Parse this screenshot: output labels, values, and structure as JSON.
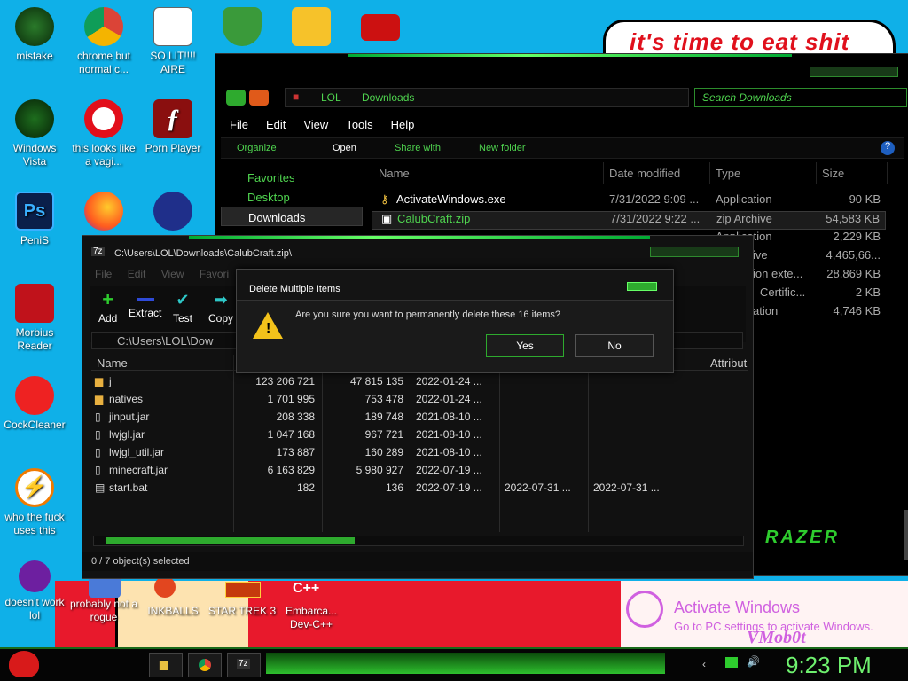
{
  "colors": {
    "desktop": "#0fb0e8",
    "accent_green": "#4fd44f",
    "title_red": "#e0101c",
    "activate": "#d060e0"
  },
  "wallpaper": {
    "caption": "it's time to eat shit",
    "tag": "VMob0t"
  },
  "desktop_icons": [
    {
      "label": "mistake",
      "icon": "green-orb-icon"
    },
    {
      "label": "chrome but normal c...",
      "icon": "chrome-icon"
    },
    {
      "label": "SO LIT!!!! AIRE",
      "icon": "solitaire-icon"
    },
    {
      "label": "",
      "icon": "shield-icon"
    },
    {
      "label": "",
      "icon": "bad-piggies-icon"
    },
    {
      "label": "",
      "icon": "emblem-icon"
    },
    {
      "label": "Windows Vista",
      "icon": "vista-orb-icon"
    },
    {
      "label": "this looks like a vagi...",
      "icon": "opera-icon"
    },
    {
      "label": "Porn Player",
      "icon": "flash-icon"
    },
    {
      "label": "PeniS",
      "icon": "photoshop-icon"
    },
    {
      "label": "",
      "icon": "firefox-icon"
    },
    {
      "label": "",
      "icon": "spider-solitaire-icon"
    },
    {
      "label": "Morbius Reader",
      "icon": "pdf-reader-icon"
    },
    {
      "label": "CockCleaner",
      "icon": "ccleaner-icon"
    },
    {
      "label": "who the fuck uses this",
      "icon": "winamp-icon"
    },
    {
      "label": "doesn't work lol",
      "icon": "yahoo-icon"
    },
    {
      "label": "probably not a rogue",
      "icon": "rogue-icon"
    },
    {
      "label": "INKBALLS",
      "icon": "inkball-icon"
    },
    {
      "label": "STAR TREK 3",
      "icon": "star-wars-icon"
    },
    {
      "label": "Embarca... Dev-C++",
      "icon": "devcpp-icon"
    }
  ],
  "explorer": {
    "breadcrumb": [
      "LOL",
      "Downloads"
    ],
    "search_placeholder": "Search Downloads",
    "menu": [
      "File",
      "Edit",
      "View",
      "Tools",
      "Help"
    ],
    "toolbar": [
      "Organize",
      "Open",
      "Share with",
      "New folder"
    ],
    "nav": [
      "Favorites",
      "Desktop",
      "Downloads"
    ],
    "columns": [
      "Name",
      "Date modified",
      "Type",
      "Size"
    ],
    "rows": [
      {
        "name": "ActivateWindows.exe",
        "date": "7/31/2022 9:09 ...",
        "type": "Application",
        "size": "90 KB"
      },
      {
        "name": "CalubCraft.zip",
        "date": "7/31/2022 9:22 ...",
        "type": "zip Archive",
        "size": "54,583 KB"
      },
      {
        "name": "",
        "date": "",
        "type": "Application",
        "size": "2,229 KB"
      },
      {
        "name": "",
        "date": "",
        "type": "ive",
        "size": "4,465,66..."
      },
      {
        "name": "",
        "date": "",
        "type": "ion exte...",
        "size": "28,869 KB"
      },
      {
        "name": "",
        "date": "",
        "type": "Certific...",
        "size": "2 KB"
      },
      {
        "name": "",
        "date": "",
        "type": "ation",
        "size": "4,746 KB"
      }
    ],
    "brand": "RAZER"
  },
  "archive": {
    "title": "C:\\Users\\LOL\\Downloads\\CalubCraft.zip\\",
    "menu": [
      "File",
      "Edit",
      "View",
      "Favori"
    ],
    "tools": [
      "Add",
      "Extract",
      "Test",
      "Copy"
    ],
    "path": "C:\\Users\\LOL\\Dow",
    "columns": [
      "Name",
      "Attribut"
    ],
    "rows": [
      {
        "name": "j",
        "size": "123 206 721",
        "packed": "47 815 135",
        "mod": "2022-01-24 ...",
        "c2": "",
        "c3": ""
      },
      {
        "name": "natives",
        "size": "1 701 995",
        "packed": "753 478",
        "mod": "2022-01-24 ...",
        "c2": "",
        "c3": ""
      },
      {
        "name": "jinput.jar",
        "size": "208 338",
        "packed": "189 748",
        "mod": "2021-08-10 ...",
        "c2": "",
        "c3": ""
      },
      {
        "name": "lwjgl.jar",
        "size": "1 047 168",
        "packed": "967 721",
        "mod": "2021-08-10 ...",
        "c2": "",
        "c3": ""
      },
      {
        "name": "lwjgl_util.jar",
        "size": "173 887",
        "packed": "160 289",
        "mod": "2021-08-10 ...",
        "c2": "",
        "c3": ""
      },
      {
        "name": "minecraft.jar",
        "size": "6 163 829",
        "packed": "5 980 927",
        "mod": "2022-07-19 ...",
        "c2": "",
        "c3": ""
      },
      {
        "name": "start.bat",
        "size": "182",
        "packed": "136",
        "mod": "2022-07-19 ...",
        "c2": "2022-07-31 ...",
        "c3": "2022-07-31 ..."
      }
    ],
    "status": "0 / 7 object(s) selected"
  },
  "dialog": {
    "title": "Delete Multiple Items",
    "message": "Are you sure you want to permanently delete these 16 items?",
    "yes": "Yes",
    "no": "No"
  },
  "activate": {
    "line1": "Activate Windows",
    "line2": "Go to PC settings to activate Windows."
  },
  "taskbar": {
    "clock": "9:23 PM"
  }
}
